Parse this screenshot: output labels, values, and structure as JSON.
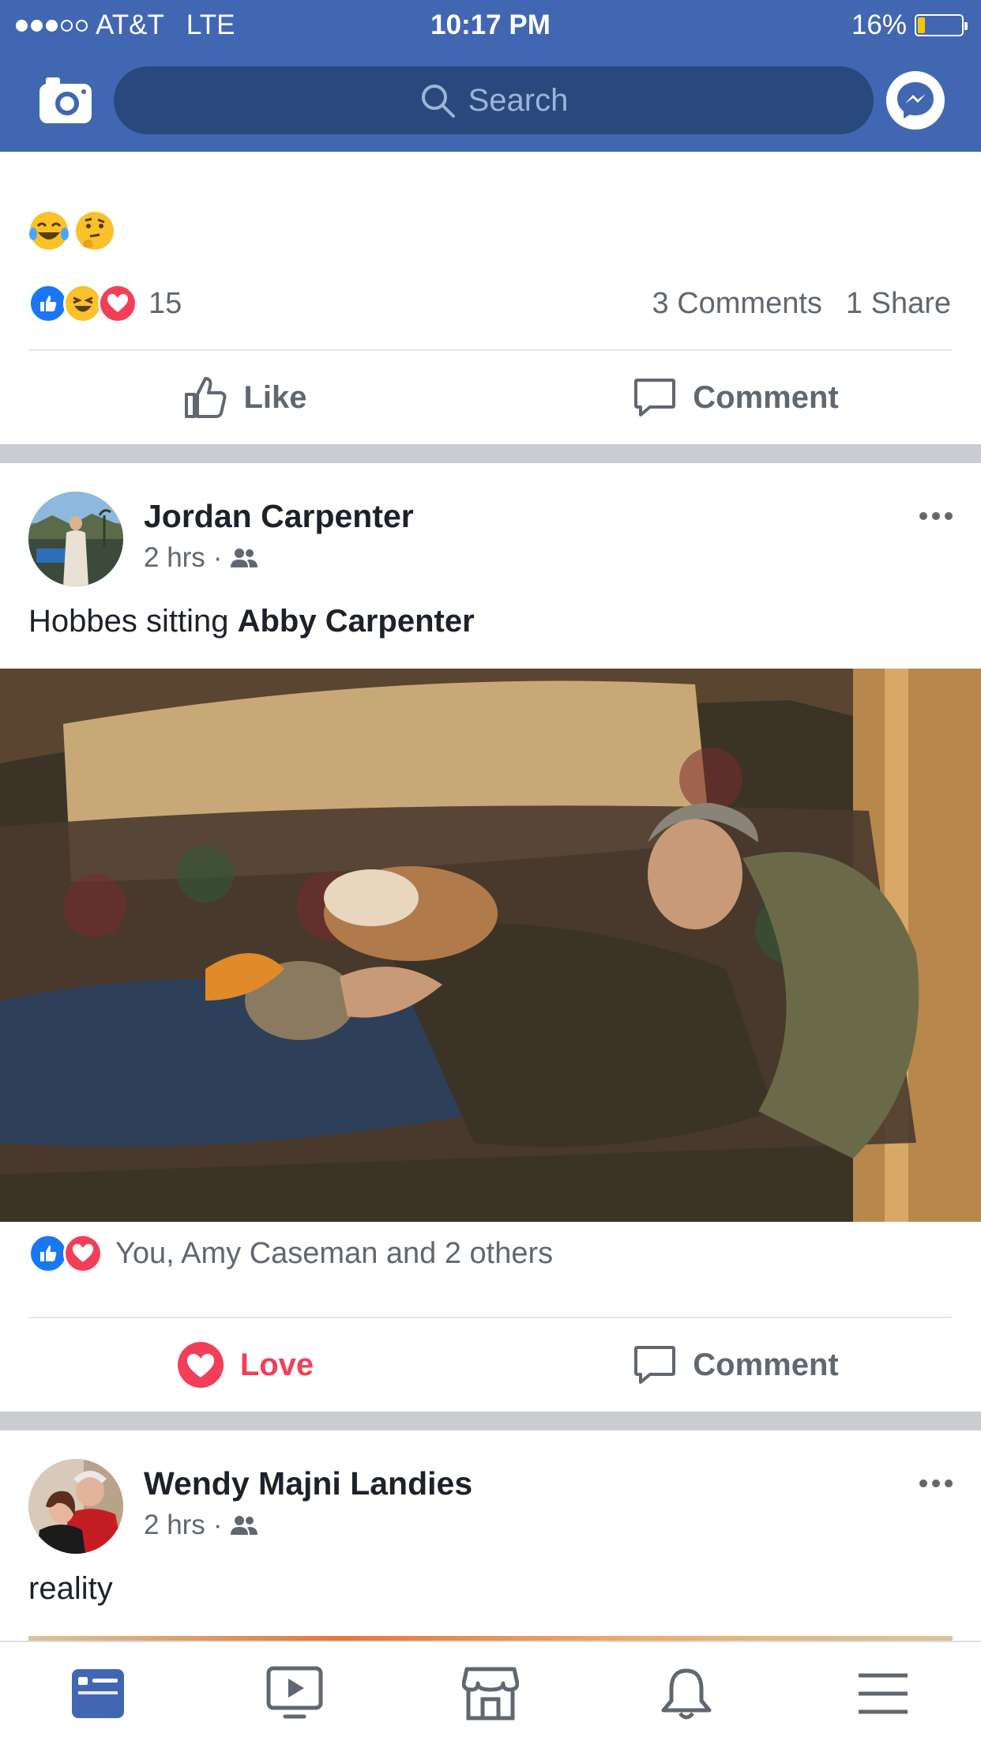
{
  "status": {
    "carrier": "AT&T",
    "network": "LTE",
    "time": "10:17 PM",
    "battery": "16%",
    "battery_level": 0.16
  },
  "nav": {
    "search_placeholder": "Search"
  },
  "post1": {
    "reaction_count": "15",
    "comments": "3 Comments",
    "shares": "1 Share",
    "like_label": "Like",
    "comment_label": "Comment"
  },
  "post2": {
    "author": "Jordan Carpenter",
    "time": "2 hrs",
    "text_prefix": "Hobbes sitting",
    "tagged": "Abby Carpenter",
    "likers": "You, Amy Caseman and 2 others",
    "love_label": "Love",
    "comment_label": "Comment"
  },
  "post3": {
    "author": "Wendy Majni Landies",
    "time": "2 hrs",
    "text": "reality"
  },
  "colors": {
    "brand": "#4267b2",
    "brand_dark": "#29487d",
    "love": "#f33e58",
    "like": "#1877f2",
    "text_secondary": "#606770"
  }
}
